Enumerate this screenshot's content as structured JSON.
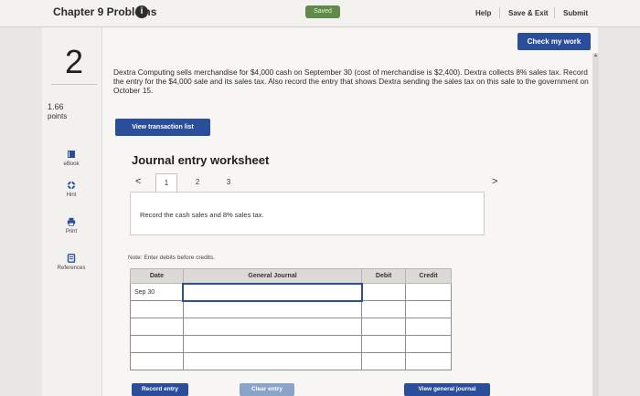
{
  "header": {
    "title": "Chapter 9 Problems",
    "saved": "Saved",
    "help": "Help",
    "save_exit": "Save & Exit",
    "submit": "Submit"
  },
  "question": {
    "number": "2",
    "points_value": "1.66",
    "points_label": "points",
    "text": "Dextra Computing sells merchandise for $4,000 cash on September 30 (cost of merchandise is $2,400). Dextra collects 8% sales tax. Record the entry for the $4,000 sale and its sales tax. Also record the entry that shows Dextra sending the sales tax on this sale to the government on October 15.",
    "check_button": "Check my work",
    "view_transaction_button": "View transaction list"
  },
  "side_tools": [
    {
      "label": "eBook",
      "icon": "book-icon"
    },
    {
      "label": "Hint",
      "icon": "lifebuoy-icon"
    },
    {
      "label": "Print",
      "icon": "printer-icon"
    },
    {
      "label": "References",
      "icon": "document-icon"
    }
  ],
  "worksheet": {
    "title": "Journal entry worksheet",
    "tabs": [
      "1",
      "2",
      "3"
    ],
    "active_tab": "1",
    "instruction": "Record the cash sales and 8% sales tax.",
    "note": "Note: Enter debits before credits.",
    "columns": [
      "Date",
      "General Journal",
      "Debit",
      "Credit"
    ],
    "rows": [
      [
        "Sep 30",
        "",
        "",
        ""
      ],
      [
        "",
        "",
        "",
        ""
      ],
      [
        "",
        "",
        "",
        ""
      ],
      [
        "",
        "",
        "",
        ""
      ],
      [
        "",
        "",
        "",
        ""
      ]
    ],
    "buttons": {
      "record": "Record entry",
      "clear": "Clear entry",
      "view_general": "View general journal"
    }
  }
}
